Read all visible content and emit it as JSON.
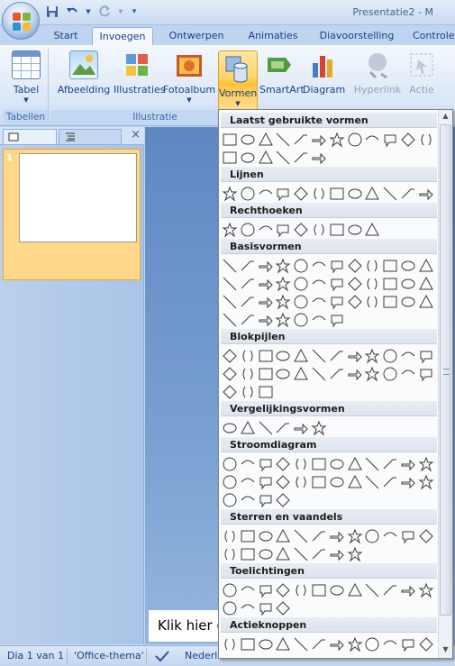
{
  "window": {
    "title": "Presentatie2 - M"
  },
  "qat": {
    "undo_icon": "undo-icon",
    "redo_icon": "redo-icon",
    "save_icon": "save-icon"
  },
  "tabs": [
    "Start",
    "Invoegen",
    "Ontwerpen",
    "Animaties",
    "Diavoorstelling",
    "Controle"
  ],
  "ribbon": {
    "buttons": [
      "Tabel",
      "Afbeelding",
      "Illustraties",
      "Fotoalbum",
      "Vormen",
      "SmartArt",
      "Diagram",
      "Hyperlink",
      "Actie"
    ],
    "groups": [
      "Tabellen",
      "Illustratie"
    ]
  },
  "slides": {
    "thumb_number": "1"
  },
  "notes": {
    "placeholder": "Klik hier o"
  },
  "status": {
    "slide": "Dia 1 van 1",
    "theme": "'Office-thema'",
    "language": "Nederla"
  },
  "menu": {
    "categories": [
      "Laatst gebruikte vormen",
      "Lijnen",
      "Rechthoeken",
      "Basisvormen",
      "Blokpijlen",
      "Vergelijkingsvormen",
      "Stroomdiagram",
      "Sterren en vaandels",
      "Toelichtingen",
      "Actieknoppen"
    ]
  },
  "colors": {
    "accent": "#ffc13b",
    "ribbon": "#dbe7f6",
    "canvas": "#7aa0d2"
  }
}
